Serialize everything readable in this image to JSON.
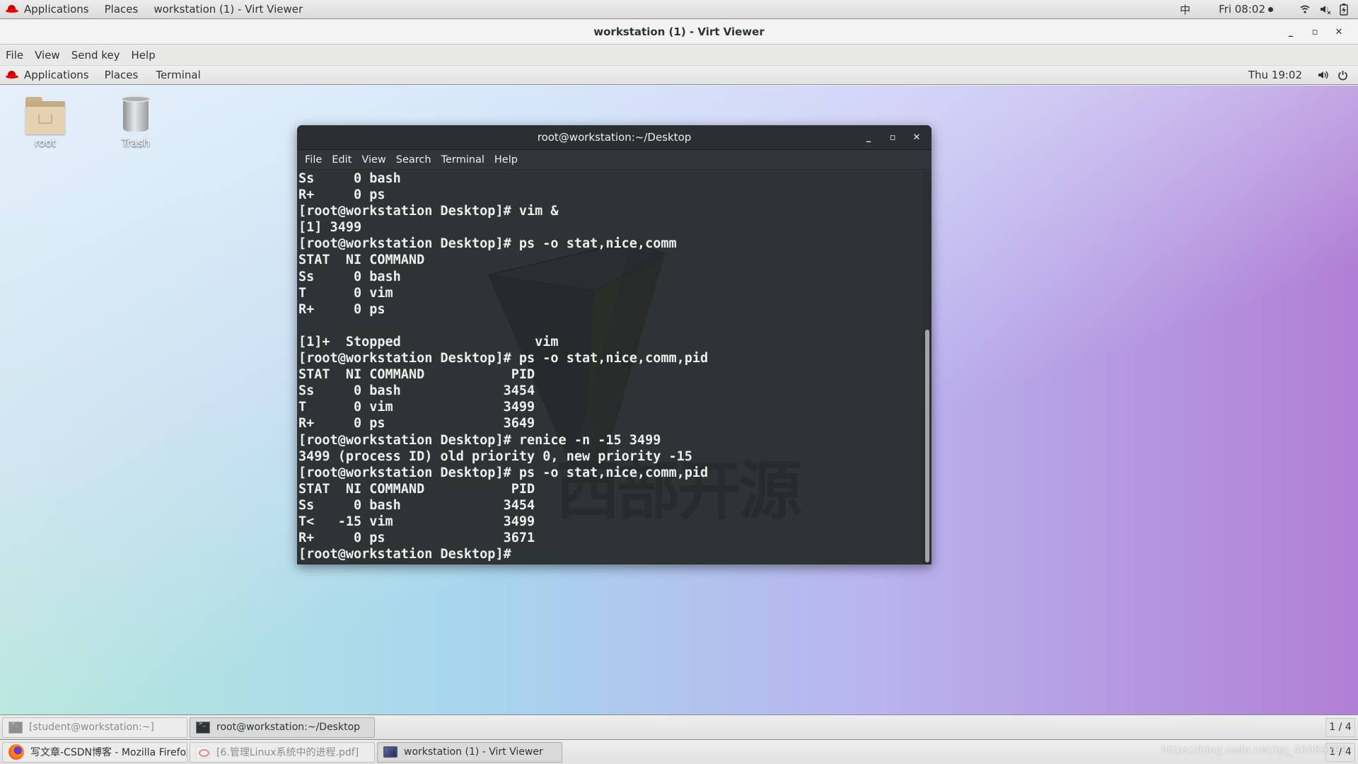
{
  "host_bar": {
    "applications": "Applications",
    "places": "Places",
    "active_window": "workstation (1) - Virt Viewer",
    "input_method": "中",
    "clock": "Fri 08:02",
    "icons": [
      "wifi-icon",
      "volume-muted-icon",
      "battery-charging-icon"
    ]
  },
  "virt_viewer": {
    "title": "workstation (1) - Virt Viewer",
    "menu": [
      "File",
      "View",
      "Send key",
      "Help"
    ]
  },
  "guest_panel": {
    "applications": "Applications",
    "places": "Places",
    "terminal": "Terminal",
    "clock": "Thu 19:02",
    "icons": [
      "volume-icon",
      "power-icon"
    ]
  },
  "desktop_icons": [
    {
      "label": "root",
      "icon": "home-folder-icon"
    },
    {
      "label": "Trash",
      "icon": "trash-icon"
    }
  ],
  "terminal": {
    "title": "root@workstation:~/Desktop",
    "menu": [
      "File",
      "Edit",
      "View",
      "Search",
      "Terminal",
      "Help"
    ],
    "lines": [
      "Ss     0 bash",
      "R+     0 ps",
      "[root@workstation Desktop]# vim &",
      "[1] 3499",
      "[root@workstation Desktop]# ps -o stat,nice,comm",
      "STAT  NI COMMAND",
      "Ss     0 bash",
      "T      0 vim",
      "R+     0 ps",
      "",
      "[1]+  Stopped                 vim",
      "[root@workstation Desktop]# ps -o stat,nice,comm,pid",
      "STAT  NI COMMAND           PID",
      "Ss     0 bash             3454",
      "T      0 vim              3499",
      "R+     0 ps               3649",
      "[root@workstation Desktop]# renice -n -15 3499",
      "3499 (process ID) old priority 0, new priority -15",
      "[root@workstation Desktop]# ps -o stat,nice,comm,pid",
      "STAT  NI COMMAND           PID",
      "Ss     0 bash             3454",
      "T<   -15 vim              3499",
      "R+     0 ps               3671",
      "[root@workstation Desktop]# "
    ],
    "watermark_text": "西部开源"
  },
  "taskbar_guest": {
    "tasks": [
      {
        "label": "[student@workstation:~]",
        "icon": "terminal-icon",
        "state": "minimized"
      },
      {
        "label": "root@workstation:~/Desktop",
        "icon": "terminal-icon",
        "state": "active"
      }
    ],
    "workspace": "1 / 4"
  },
  "taskbar_host": {
    "tasks": [
      {
        "label": "写文章-CSDN博客 - Mozilla Firefox",
        "icon": "firefox-icon",
        "state": "normal"
      },
      {
        "label": "[6.管理Linux系统中的进程.pdf]",
        "icon": "pdf-icon",
        "state": "minimized"
      },
      {
        "label": "workstation (1) - Virt Viewer",
        "icon": "virt-viewer-icon",
        "state": "active"
      }
    ],
    "workspace": "1 / 4"
  },
  "url_watermark": "https://blog.csdn.net/qq_46089299"
}
